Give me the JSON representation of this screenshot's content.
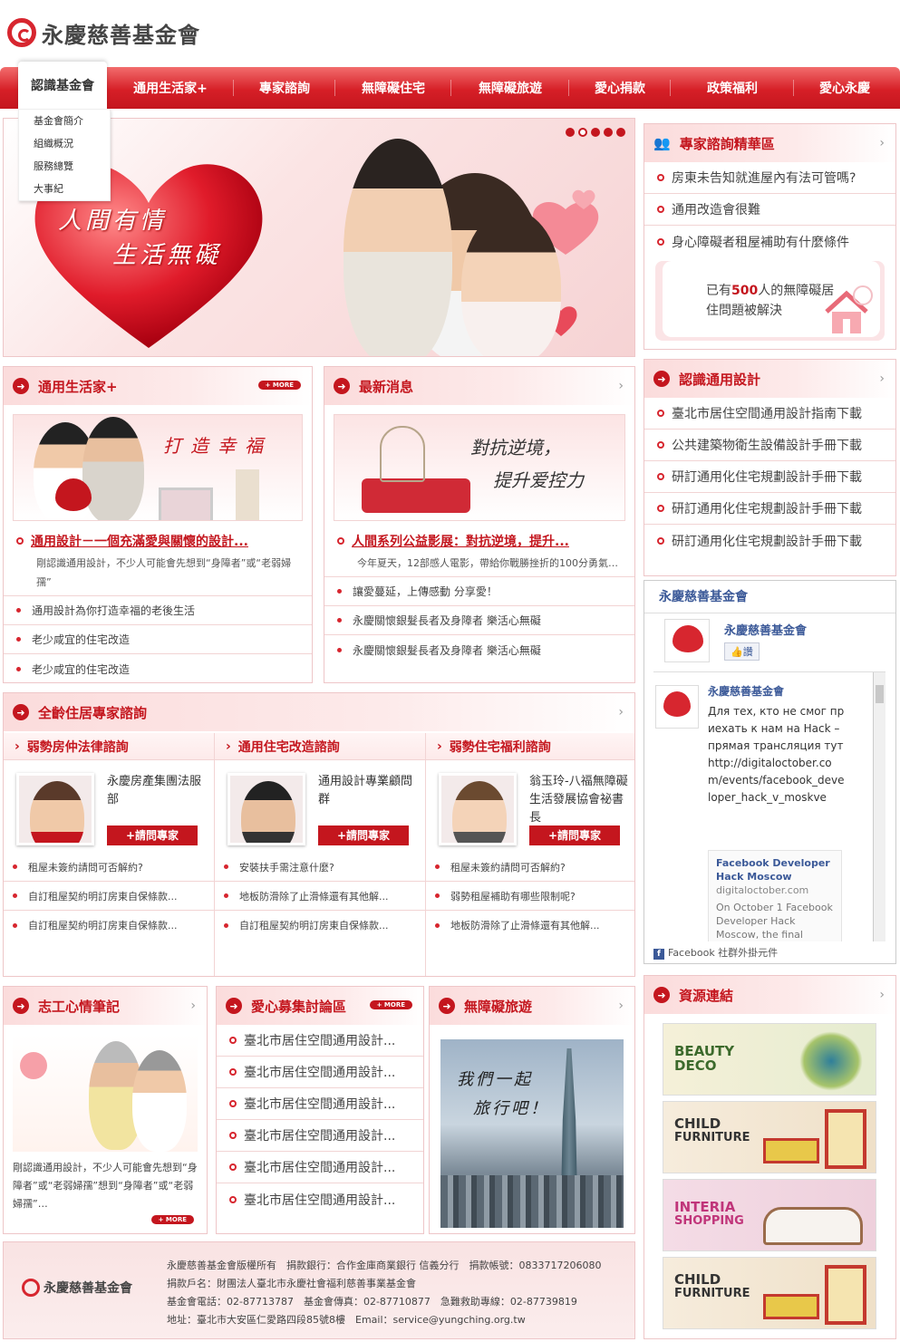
{
  "site": {
    "logo_text": "永慶慈善基金會"
  },
  "nav": {
    "items": [
      "認識基金會",
      "通用生活家+",
      "專家諮詢",
      "無障礙住宅",
      "無障礙旅遊",
      "愛心捐款",
      "政策福利",
      "愛心永慶"
    ],
    "submenu": [
      "基金會簡介",
      "組織概況",
      "服務總覽",
      "大事紀"
    ]
  },
  "hero": {
    "line1": "人間有情",
    "line2": "生活無礙"
  },
  "consult": {
    "title": "專家諮詢精華區",
    "items": [
      "房東未告知就進屋內有法可管嗎?",
      "通用改造會很難",
      "身心障礙者租屋補助有什麼條件"
    ],
    "banner_pre": "已有",
    "banner_num": "500",
    "banner_post": "人的無障礙居",
    "banner_line2": "住問題被解決"
  },
  "universal_design": {
    "title": "認識通用設計",
    "items": [
      "臺北市居住空間通用設計指南下載",
      "公共建築物衛生設備設計手冊下載",
      "研訂通用化住宅規劃設計手冊下載",
      "研訂通用化住宅規劃設計手冊下載",
      "研訂通用化住宅規劃設計手冊下載"
    ]
  },
  "living": {
    "title": "通用生活家+",
    "more": "+ MORE",
    "img_text": "打造幸福",
    "feature_title": "通用設計－一個充滿愛與關懷的設計...",
    "feature_desc": "剛認識通用設計，不少人可能會先想到“身障者”或“老弱婦孺”",
    "items": [
      "通用設計為你打造幸福的老後生活",
      "老少咸宜的住宅改造",
      "老少咸宜的住宅改造"
    ]
  },
  "news": {
    "title": "最新消息",
    "img_text1": "對抗逆境，",
    "img_text2": "提升爱控力",
    "feature_title": "人間系列公益影展：對抗逆境，提升...",
    "feature_desc": "今年夏天，12部感人電影，帶給你戰勝挫折的100分勇氣…",
    "items": [
      "讓愛蔓延，上傳感動 分享愛！",
      "永慶關懷銀髮長者及身障者 樂活心無礙",
      "永慶關懷銀髮長者及身障者 樂活心無礙"
    ]
  },
  "experts": {
    "title": "全齡住居專家諮詢",
    "ask_label": "+請問專家",
    "cols": [
      {
        "head": "弱勢房仲法律諮詢",
        "name": "永慶房產集團法服部",
        "items": [
          "租屋未簽約請問可否解約?",
          "自訂租屋契約明訂房東自保條款...",
          "自訂租屋契約明訂房東自保條款..."
        ]
      },
      {
        "head": "通用住宅改造諮詢",
        "name": "通用設計專業顧問群",
        "items": [
          "安裝扶手需注意什麼?",
          "地板防滑除了止滑條還有其他解...",
          "自訂租屋契約明訂房東自保條款..."
        ]
      },
      {
        "head": "弱勢住宅福利諮詢",
        "name": "翁玉玲-八福無障礙生活發展協會祕書長",
        "items": [
          "租屋未簽約請問可否解約?",
          "弱勢租屋補助有哪些限制呢?",
          "地板防滑除了止滑條還有其他解..."
        ]
      }
    ]
  },
  "volunteer": {
    "title": "志工心情筆記",
    "desc": "剛認識通用設計，不少人可能會先想到“身障者”或“老弱婦孺”想到“身障者”或“老弱婦孺”…",
    "more": "+ MORE"
  },
  "forum": {
    "title": "愛心募集討論區",
    "more": "+ MORE",
    "items": [
      "臺北市居住空間通用設計...",
      "臺北市居住空間通用設計...",
      "臺北市居住空間通用設計...",
      "臺北市居住空間通用設計...",
      "臺北市居住空間通用設計...",
      "臺北市居住空間通用設計..."
    ]
  },
  "travel": {
    "title": "無障礙旅遊",
    "img_text1": "我們一起",
    "img_text2": "旅行吧！"
  },
  "facebook": {
    "title": "永慶慈善基金會",
    "page_name": "永慶慈善基金會",
    "like": "讚",
    "post_author": "永慶慈善基金會",
    "post_text": "Для тех, кто не смог приехать к нам на Hack – прямая трансляция тут http://digitaloctober.com/events/facebook_developer_hack_v_moskve",
    "link_title": "Facebook Developer Hack Moscow",
    "link_domain": "digitaloctober.com",
    "link_desc": "On October 1 Facebook Developer Hack Moscow, the final",
    "footer": "Facebook 社群外掛元件"
  },
  "resources": {
    "title": "資源連結",
    "ads": [
      {
        "l1": "BEAUTY",
        "l2": "DECO",
        "color": "#3c6a2c"
      },
      {
        "l1": "CHILD",
        "l2": "FURNITURE",
        "color": "#333333"
      },
      {
        "l1": "INTERIA",
        "l2": "SHOPPING",
        "color": "#c0357a"
      },
      {
        "l1": "CHILD",
        "l2": "FURNITURE",
        "color": "#333333"
      }
    ]
  },
  "footer": {
    "logo_text": "永慶慈善基金會",
    "line1": "永慶慈善基金會版權所有　捐款銀行：合作金庫商業銀行 信義分行　捐款帳號：0833717206080",
    "line2": "捐款戶名：財團法人臺北市永慶社會福利慈善事業基金會",
    "line3": "基金會電話：02-87713787　基金會傳真：02-87710877　急難救助專線：02-87739819",
    "line4": "地址：臺北市大安區仁愛路四段85號8樓　Email：service@yungching.org.tw"
  },
  "colors": {
    "accent": "#c4161e",
    "pink": "#fbdcdc"
  }
}
